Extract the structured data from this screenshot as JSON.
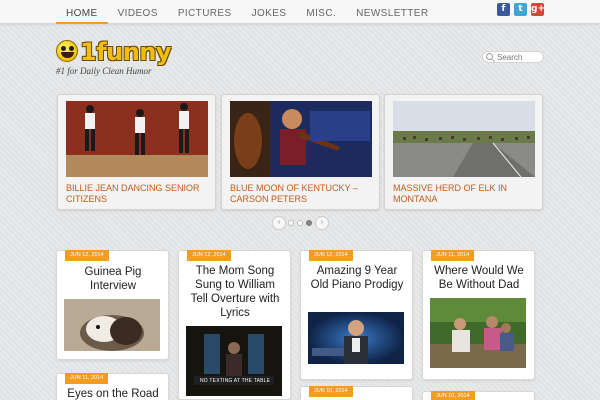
{
  "nav": {
    "items": [
      {
        "label": "HOME",
        "active": true
      },
      {
        "label": "VIDEOS"
      },
      {
        "label": "PICTURES"
      },
      {
        "label": "JOKES"
      },
      {
        "label": "MISC."
      },
      {
        "label": "NEWSLETTER"
      }
    ]
  },
  "social": {
    "facebook": "f",
    "twitter": "t",
    "googleplus": "g+"
  },
  "header": {
    "logo_text": "1funny",
    "tagline": "#1 for Daily Clean Humor",
    "search_placeholder": "Search"
  },
  "slider": {
    "slides": [
      {
        "caption": "BILLIE JEAN DANCING SENIOR CITIZENS"
      },
      {
        "caption": "BLUE MOON OF KENTUCKY – CARSON PETERS"
      },
      {
        "caption": "MASSIVE HERD OF ELK IN MONTANA"
      }
    ],
    "prev": "‹",
    "next": "›",
    "active_index": 3
  },
  "posts": [
    {
      "date": "JUN 12, 2014",
      "title": "Guinea Pig Interview"
    },
    {
      "date": "JUN 12, 2014",
      "title": "The Mom Song Sung to William Tell Overture with Lyrics",
      "overlay": "NO TEXTING AT THE TABLE"
    },
    {
      "date": "JUN 12, 2014",
      "title": "Amazing 9 Year Old Piano Prodigy"
    },
    {
      "date": "JUN 11, 2014",
      "title": "Where Would We Be Without Dad"
    },
    {
      "date": "JUN 11, 2014",
      "title": "Eyes on the Road"
    },
    {
      "date": "JUN 10, 2014",
      "title": ""
    },
    {
      "date": "JUN 10, 2014",
      "title": ""
    }
  ]
}
